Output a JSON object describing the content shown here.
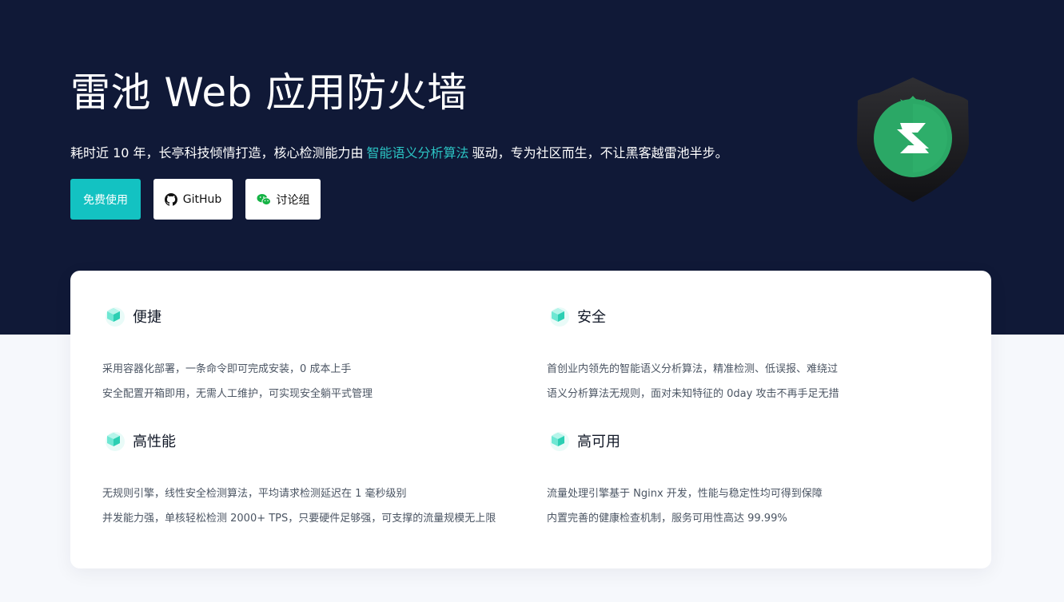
{
  "hero": {
    "title": "雷池 Web 应用防火墙",
    "subtitle_before": "耗时近 10 年，长亭科技倾情打造，核心检测能力由",
    "subtitle_highlight": "智能语义分析算法",
    "subtitle_after": "驱动，专为社区而生，不让黑客越雷池半步。",
    "highlight_color": "#2bc3c3"
  },
  "buttons": {
    "primary_label": "免费使用",
    "github_label": "GitHub",
    "group_label": "讨论组",
    "primary_color": "#13c2c2"
  },
  "icons": {
    "github": "github-icon",
    "wechat": "wechat-icon",
    "feature": "cube-icon",
    "logo": "shield-logo-icon"
  },
  "features": [
    {
      "title": "便捷",
      "lines": [
        "采用容器化部署，一条命令即可完成安装，0 成本上手",
        "安全配置开箱即用，无需人工维护，可实现安全躺平式管理"
      ]
    },
    {
      "title": "安全",
      "lines": [
        "首创业内领先的智能语义分析算法，精准检测、低误报、难绕过",
        "语义分析算法无规则，面对未知特征的 0day 攻击不再手足无措"
      ]
    },
    {
      "title": "高性能",
      "lines": [
        "无规则引擎，线性安全检测算法，平均请求检测延迟在 1 毫秒级别",
        "并发能力强，单核轻松检测 2000+ TPS，只要硬件足够强，可支撑的流量规模无上限"
      ]
    },
    {
      "title": "高可用",
      "lines": [
        "流量处理引擎基于 Nginx 开发，性能与稳定性均可得到保障",
        "内置完善的健康检查机制，服务可用性高达 99.99%"
      ]
    }
  ]
}
